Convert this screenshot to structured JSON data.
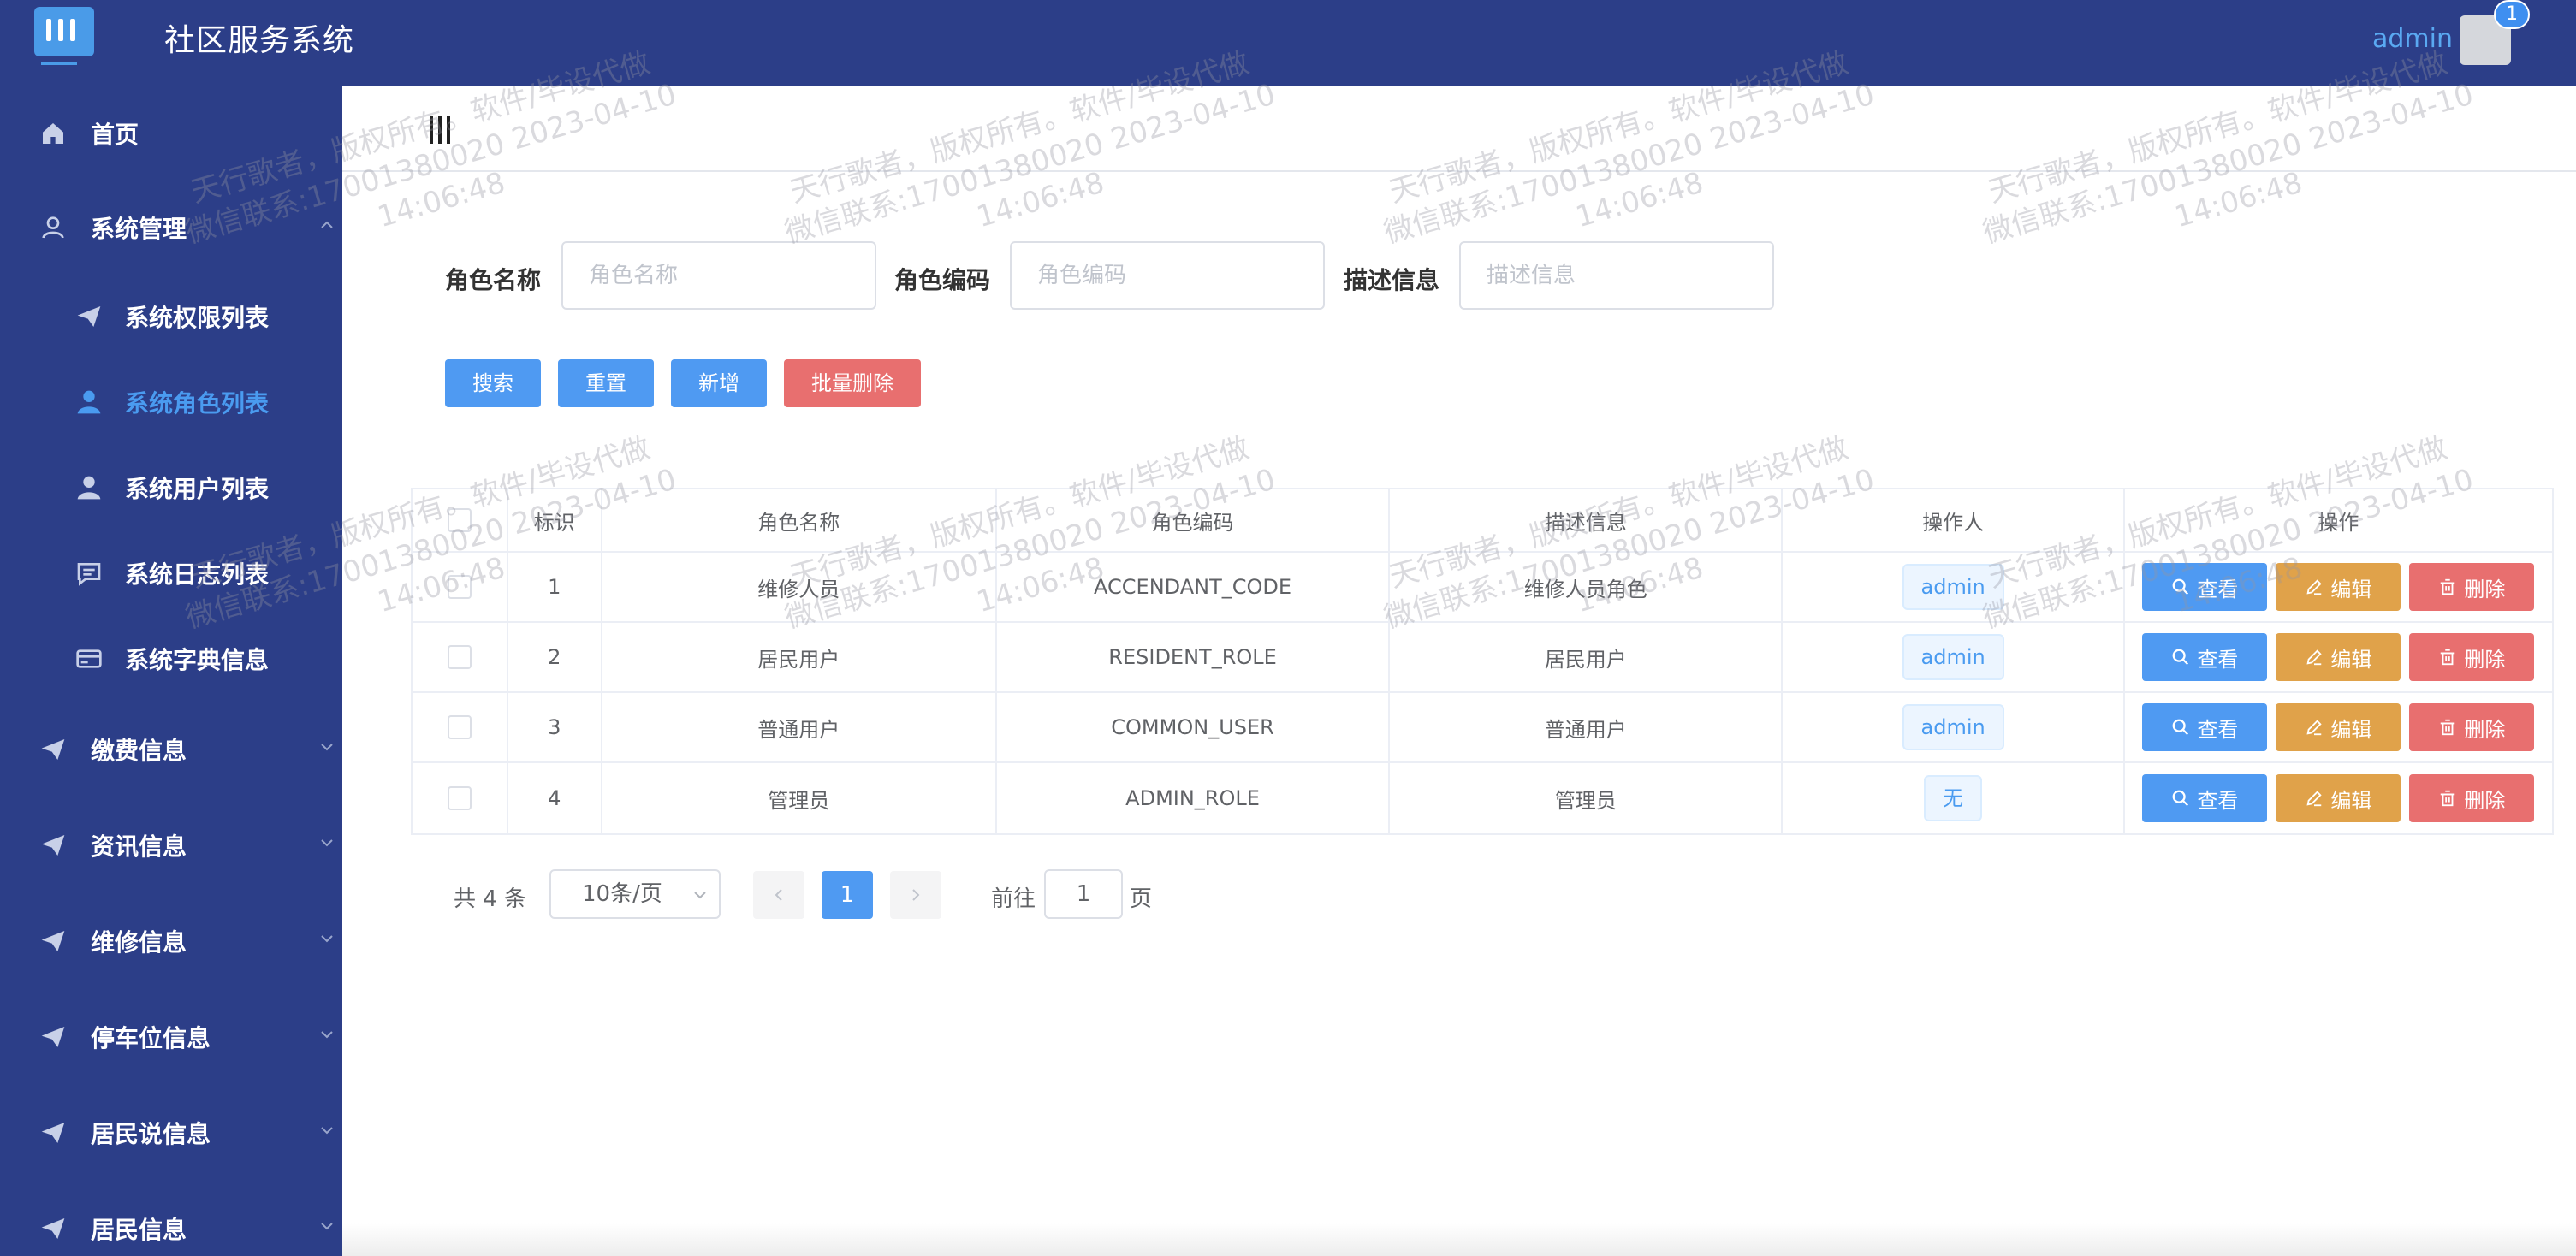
{
  "header": {
    "title": "社区服务系统",
    "user": "admin",
    "badge_count": "1"
  },
  "sidebar": {
    "items": [
      {
        "label": "首页",
        "icon": "home-icon"
      },
      {
        "label": "系统管理",
        "icon": "user-outline-icon"
      },
      {
        "label": "系统权限列表",
        "icon": "paper-plane-icon"
      },
      {
        "label": "系统角色列表",
        "icon": "user-icon"
      },
      {
        "label": "系统用户列表",
        "icon": "user-icon"
      },
      {
        "label": "系统日志列表",
        "icon": "chat-icon"
      },
      {
        "label": "系统字典信息",
        "icon": "card-icon"
      },
      {
        "label": "缴费信息",
        "icon": "paper-plane-icon"
      },
      {
        "label": "资讯信息",
        "icon": "paper-plane-icon"
      },
      {
        "label": "维修信息",
        "icon": "paper-plane-icon"
      },
      {
        "label": "停车位信息",
        "icon": "paper-plane-icon"
      },
      {
        "label": "居民说信息",
        "icon": "paper-plane-icon"
      },
      {
        "label": "居民信息",
        "icon": "paper-plane-icon"
      }
    ],
    "active_item": "系统角色列表"
  },
  "search": {
    "fields": [
      {
        "label": "角色名称",
        "placeholder": "角色名称"
      },
      {
        "label": "角色编码",
        "placeholder": "角色编码"
      },
      {
        "label": "描述信息",
        "placeholder": "描述信息"
      }
    ],
    "buttons": {
      "search": "搜索",
      "reset": "重置",
      "add": "新增",
      "batch_delete": "批量删除"
    }
  },
  "table": {
    "columns": [
      "标识",
      "角色名称",
      "角色编码",
      "描述信息",
      "操作人",
      "操作"
    ],
    "rows": [
      {
        "id": "1",
        "name": "维修人员",
        "code": "ACCENDANT_CODE",
        "desc": "维修人员角色",
        "operator": "admin"
      },
      {
        "id": "2",
        "name": "居民用户",
        "code": "RESIDENT_ROLE",
        "desc": "居民用户",
        "operator": "admin"
      },
      {
        "id": "3",
        "name": "普通用户",
        "code": "COMMON_USER",
        "desc": "普通用户",
        "operator": "admin"
      },
      {
        "id": "4",
        "name": "管理员",
        "code": "ADMIN_ROLE",
        "desc": "管理员",
        "operator": "无"
      }
    ],
    "actions": {
      "view": "查看",
      "edit": "编辑",
      "delete": "删除"
    }
  },
  "pagination": {
    "total": "共 4 条",
    "page_size": "10条/页",
    "current_page": "1",
    "goto_label": "前往",
    "goto_value": "1",
    "page_suffix": "页"
  },
  "watermark": {
    "line1": "天行歌者，版权所有。软件/毕设代做",
    "line2": "微信联系:17001380020 2023-04-10",
    "line3": "14:06:48"
  },
  "colors": {
    "header_bg": "#2c3e88",
    "sidebar_bg": "#2c3e88",
    "active_accent": "#4a9bf0",
    "primary_button": "#4f9af2",
    "danger_button": "#e86f6f",
    "warning_button": "#e0a24a"
  }
}
